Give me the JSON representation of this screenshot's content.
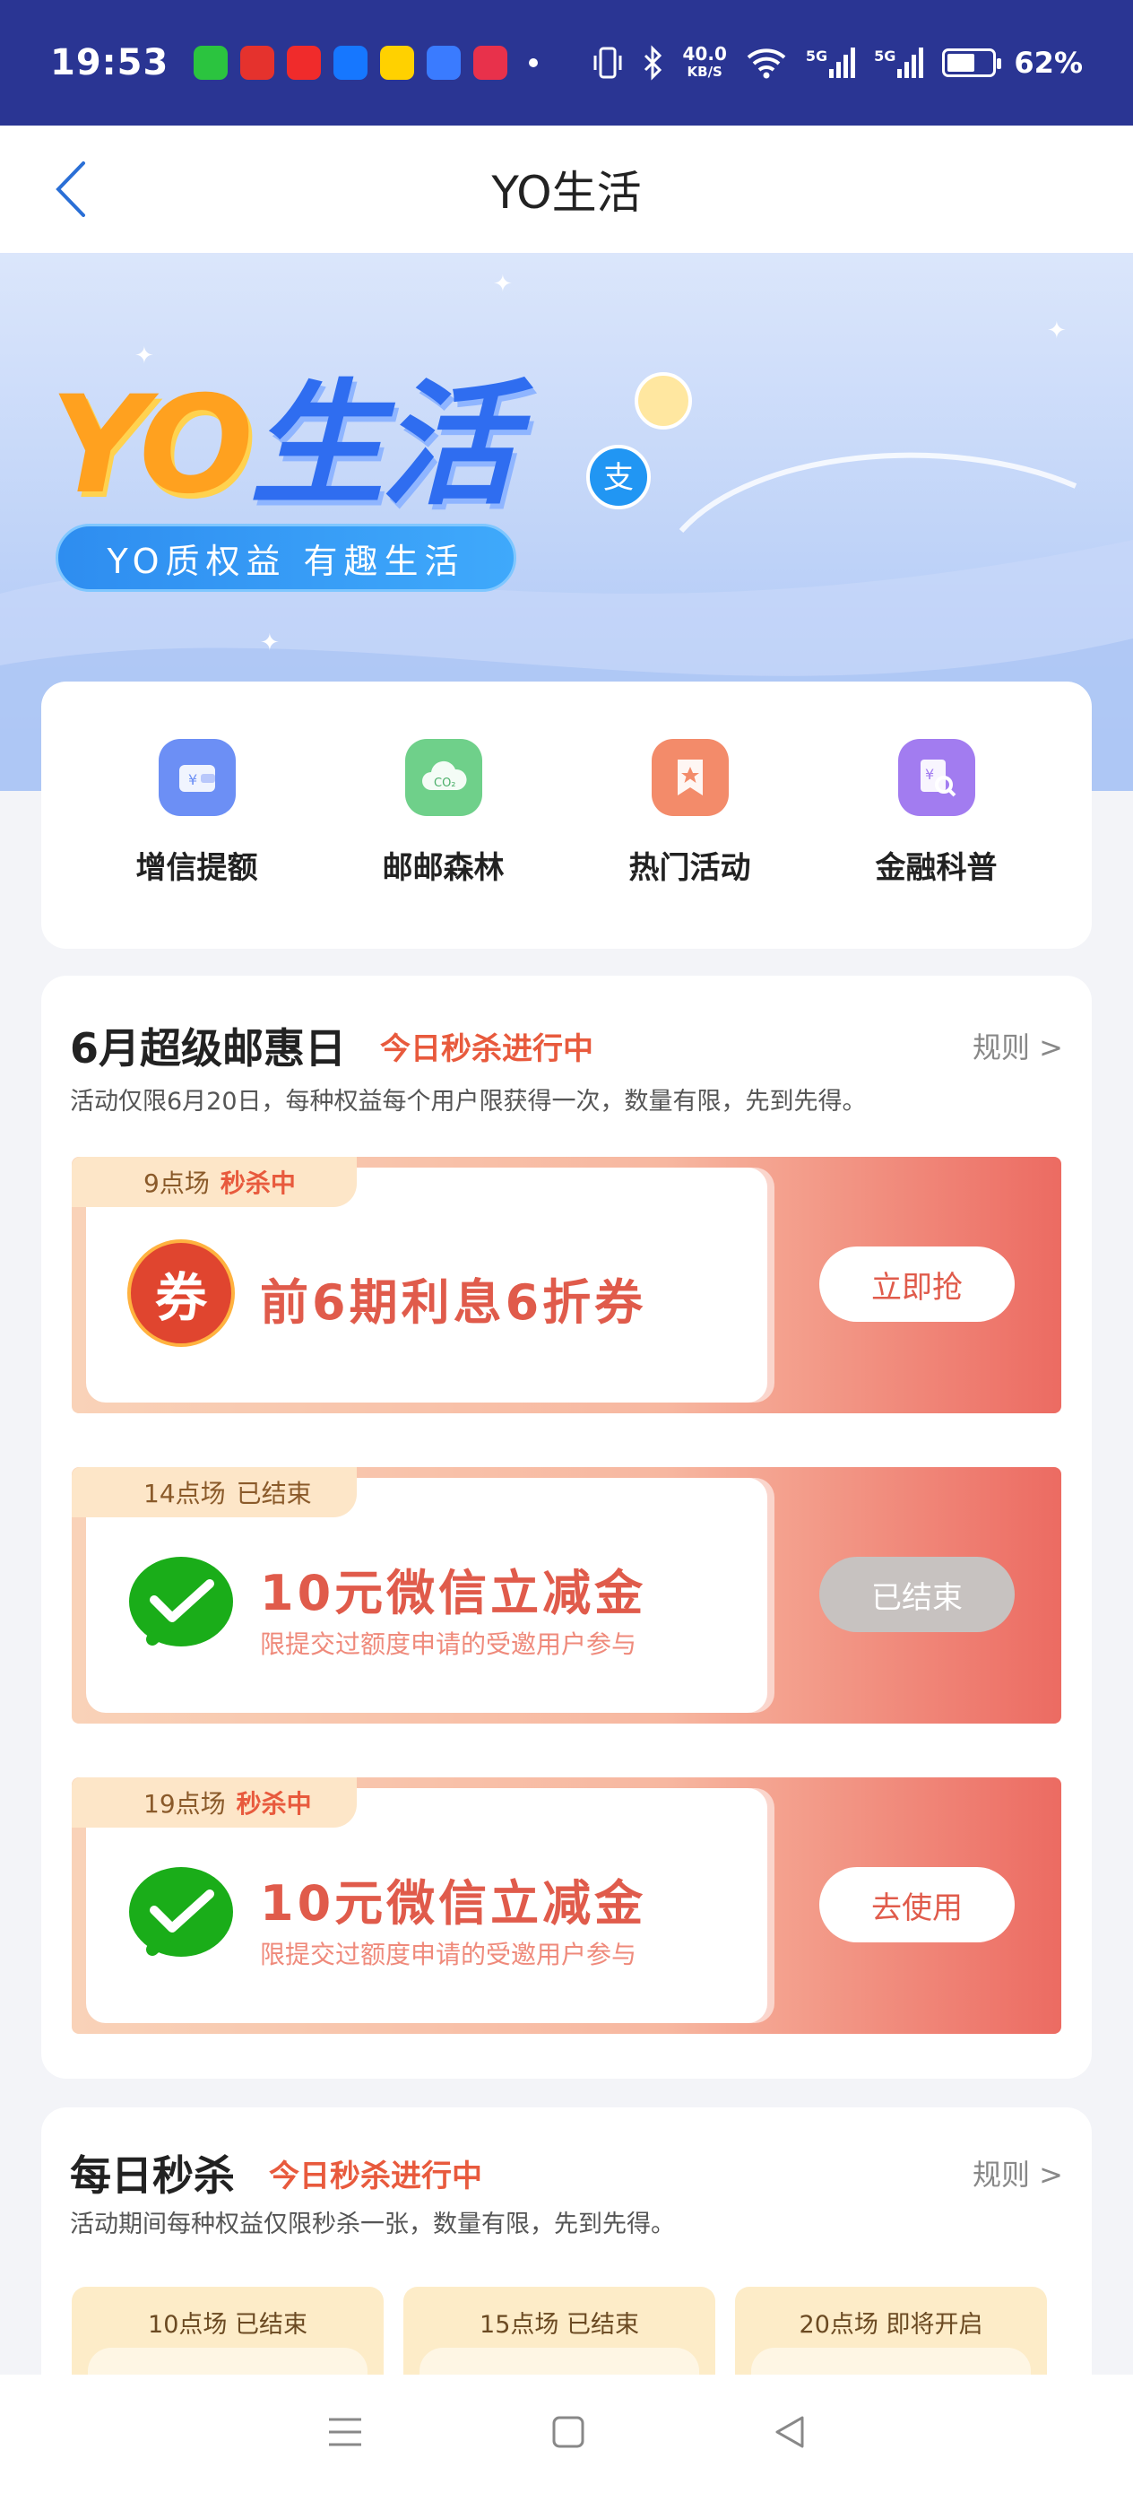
{
  "status_bar": {
    "time": "19:53",
    "net_speed_value": "40.0",
    "net_speed_unit": "KB/S",
    "signal_1": "5G",
    "signal_2": "5G",
    "battery_percent": "62%",
    "battery_level": 0.62,
    "notification_app_colors": [
      "#2bc43f",
      "#e5322d",
      "#f02b2b",
      "#1677ff",
      "#ffd100",
      "#3a7bff",
      "#e8314b"
    ]
  },
  "nav": {
    "title": "YO生活"
  },
  "banner": {
    "title_yo": "YO",
    "title_life": "生活",
    "slogan": "YO质权益 有趣生活"
  },
  "shortcuts": [
    {
      "label": "增信提额",
      "icon": "wallet-icon",
      "color": "#6c8ff5"
    },
    {
      "label": "邮邮森林",
      "icon": "co2-cloud-icon",
      "color": "#6fd08a"
    },
    {
      "label": "热门活动",
      "icon": "star-bookmark-icon",
      "color": "#f38b6a"
    },
    {
      "label": "金融科普",
      "icon": "finance-search-icon",
      "color": "#a27cf0"
    }
  ],
  "promo": {
    "title": "6月超级邮惠日",
    "status": "今日秒杀进行中",
    "rules": "规则 >",
    "desc": "活动仅限6月20日，每种权益每个用户限获得一次，数量有限，先到先得。",
    "items": [
      {
        "session": "9点场",
        "session_status": "秒杀中",
        "name": "前6期利息6折券",
        "sub": "",
        "button": "立即抢",
        "icon": "coupon-icon",
        "icon_text": "券",
        "ended": false
      },
      {
        "session": "14点场",
        "session_status": "已结束",
        "name": "10元微信立减金",
        "sub": "限提交过额度申请的受邀用户参与",
        "button": "已结束",
        "icon": "wechat-pay-icon",
        "ended": true
      },
      {
        "session": "19点场",
        "session_status": "秒杀中",
        "name": "10元微信立减金",
        "sub": "限提交过额度申请的受邀用户参与",
        "button": "去使用",
        "icon": "wechat-pay-icon",
        "ended": false
      }
    ]
  },
  "daily": {
    "title": "每日秒杀",
    "status": "今日秒杀进行中",
    "rules": "规则 >",
    "desc": "活动期间每种权益仅限秒杀一张，数量有限，先到先得。",
    "slots": [
      {
        "session": "10点场",
        "status": "已结束"
      },
      {
        "session": "15点场",
        "status": "已结束"
      },
      {
        "session": "20点场",
        "status": "即将开启"
      }
    ]
  },
  "colors": {
    "statusbar": "#2a3593",
    "accent_red": "#e85a3d",
    "page_bg": "#f3f4f8"
  }
}
